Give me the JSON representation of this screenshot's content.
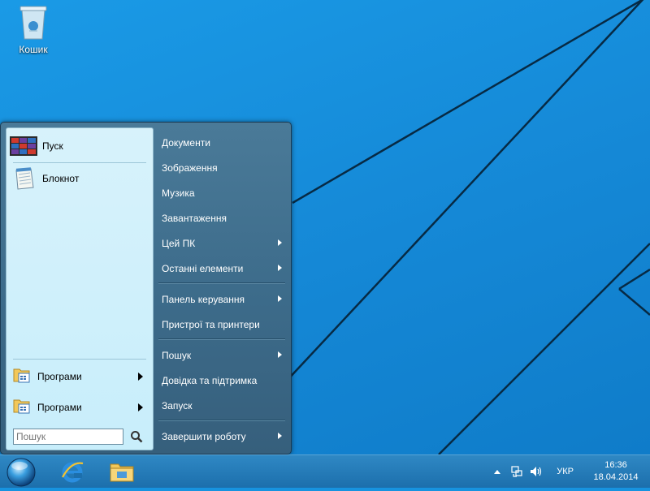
{
  "desktop": {
    "icons": [
      {
        "label": "Кошик",
        "icon": "recycle-bin-icon"
      }
    ]
  },
  "start_menu": {
    "pinned": [
      {
        "label": "Пуск",
        "icon": "start-tiles-icon"
      },
      {
        "label": "Блокнот",
        "icon": "notepad-icon"
      }
    ],
    "programs": [
      {
        "label": "Програми",
        "icon": "programs-folder-icon"
      },
      {
        "label": "Програми",
        "icon": "programs-folder-icon"
      }
    ],
    "search": {
      "placeholder": "Пошук",
      "value": ""
    },
    "right_items": [
      {
        "label": "Документи",
        "submenu": false
      },
      {
        "label": "Зображення",
        "submenu": false
      },
      {
        "label": "Музика",
        "submenu": false
      },
      {
        "label": "Завантаження",
        "submenu": false
      },
      {
        "label": "Цей ПК",
        "submenu": true
      },
      {
        "label": "Останні елементи",
        "submenu": true
      },
      {
        "label": "Панель керування",
        "submenu": true
      },
      {
        "label": "Пристрої та принтери",
        "submenu": false
      },
      {
        "label": "Пошук",
        "submenu": true
      },
      {
        "label": "Довідка та підтримка",
        "submenu": false
      },
      {
        "label": "Запуск",
        "submenu": false
      },
      {
        "label": "Завершити роботу",
        "submenu": true
      }
    ]
  },
  "taskbar": {
    "apps": [
      {
        "icon": "internet-explorer-icon"
      },
      {
        "icon": "file-explorer-icon"
      }
    ],
    "tray": {
      "language": "УКР",
      "time": "16:36",
      "date": "18.04.2014"
    }
  },
  "colors": {
    "desktop_bg": "#1793df",
    "start_menu_bg": "#3d6c8b",
    "left_pane_bg": "#c8eefb",
    "taskbar_bg": "#1c6fac"
  }
}
